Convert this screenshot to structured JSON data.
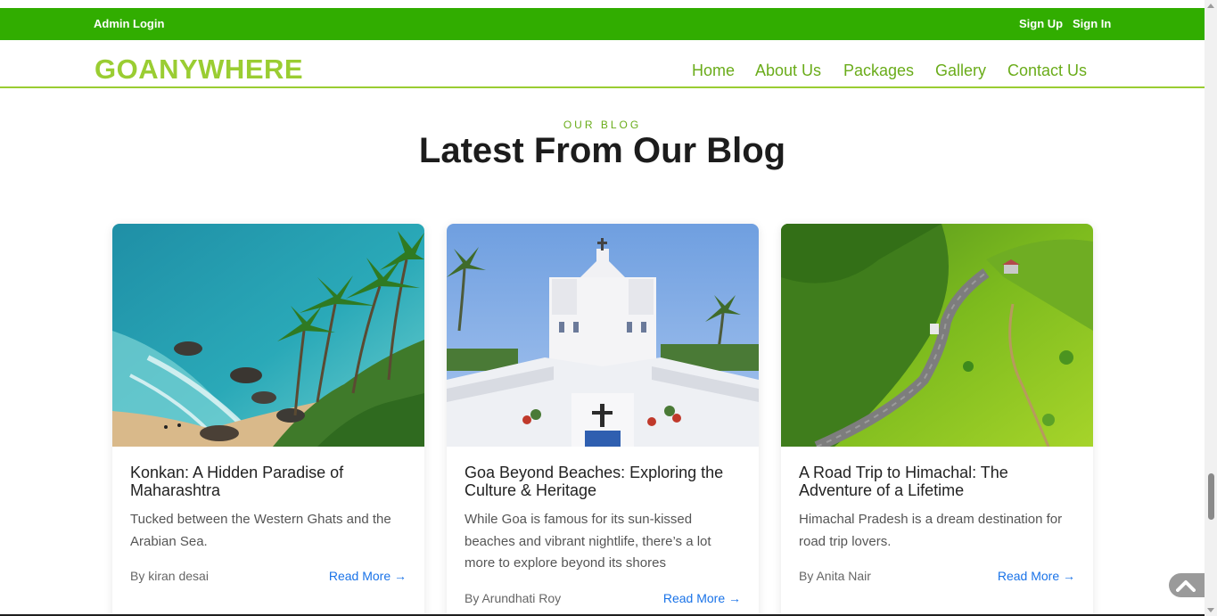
{
  "topbar": {
    "admin_login": "Admin Login",
    "sign_up": "Sign Up",
    "sign_in": "Sign In"
  },
  "brand": {
    "logo": "GOANYWHERE"
  },
  "nav": {
    "home": "Home",
    "about": "About Us",
    "packages": "Packages",
    "gallery": "Gallery",
    "contact": "Contact Us"
  },
  "blog": {
    "eyebrow": "OUR BLOG",
    "heading": "Latest From Our Blog",
    "posts": [
      {
        "title": "Konkan: A Hidden Paradise of Maharashtra",
        "excerpt": "Tucked between the Western Ghats and the Arabian Sea.",
        "author": "By kiran desai",
        "link": "Read More →"
      },
      {
        "title": "Goa Beyond Beaches: Exploring the Culture & Heritage",
        "excerpt": "While Goa is famous for its sun-kissed beaches and vibrant nightlife, there’s a lot more to explore beyond its shores",
        "author": "By Arundhati Roy",
        "link": "Read More →"
      },
      {
        "title": "A Road Trip to Himachal: The Adventure of a Lifetime",
        "excerpt": "Himachal Pradesh is a dream destination for road trip lovers.",
        "author": "By Anita Nair",
        "link": "Read More →"
      }
    ]
  },
  "colors": {
    "topbar": "#31ad00",
    "brand": "#9acd32",
    "nav": "#6aac1a",
    "link": "#1a73e8"
  },
  "icons": {
    "back_to_top": "chevron-up-icon"
  }
}
